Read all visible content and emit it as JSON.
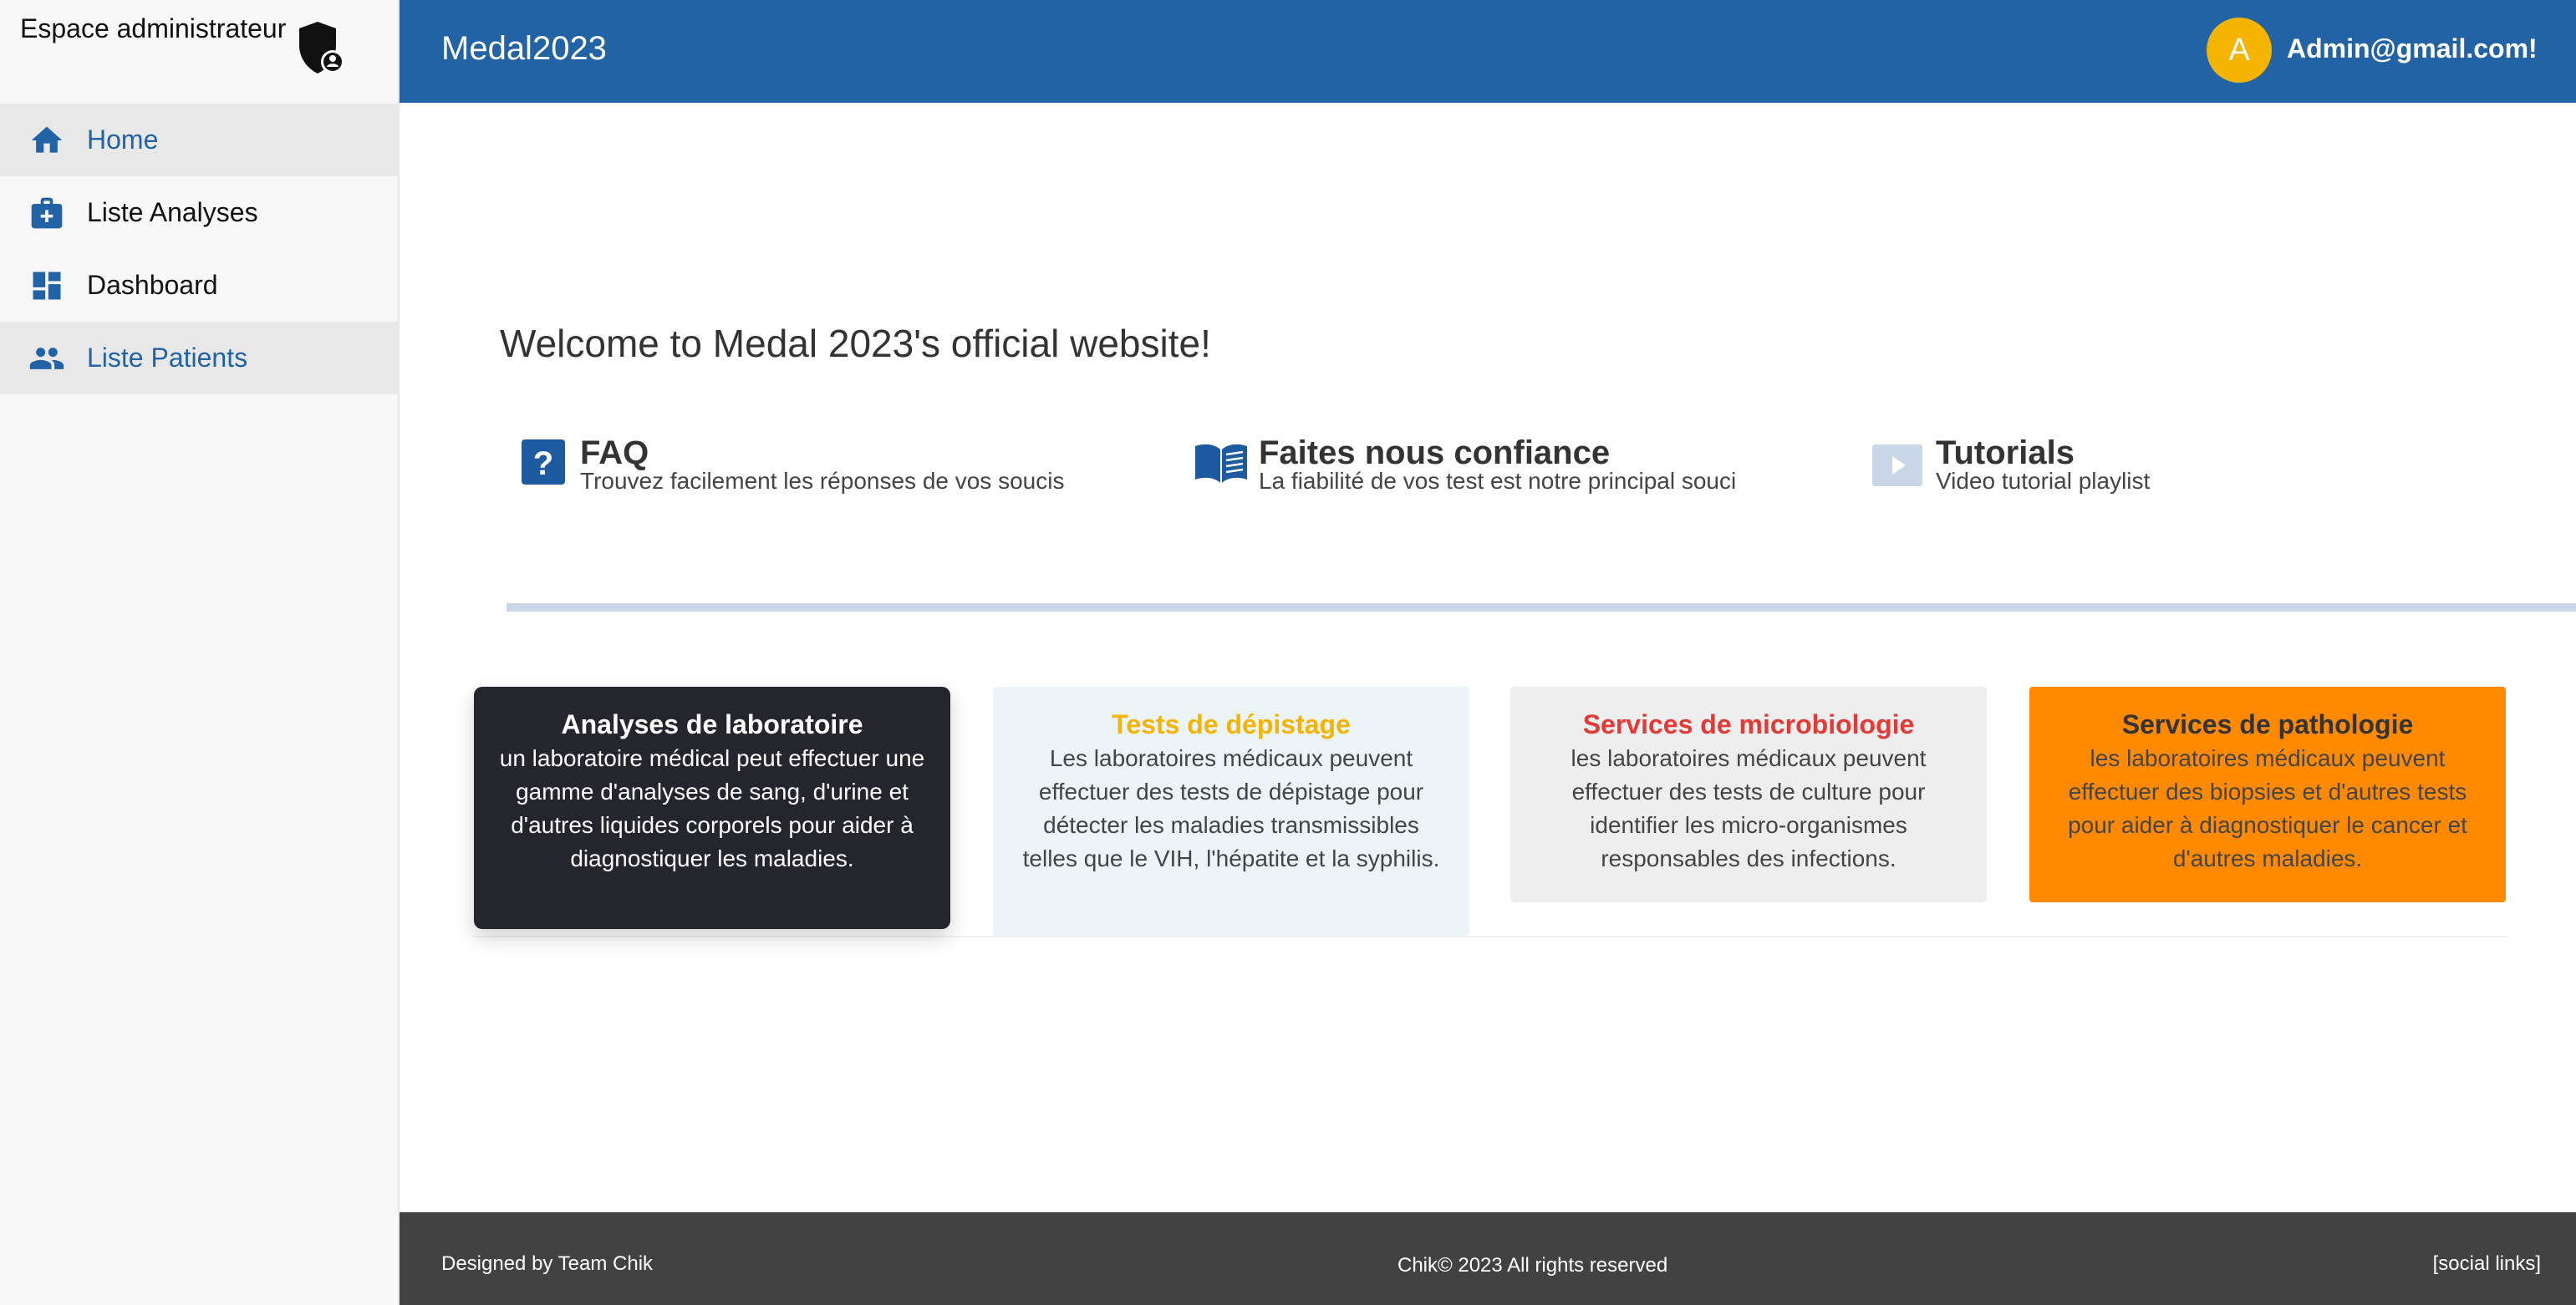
{
  "sidebar": {
    "brand": "Espace administrateur",
    "items": [
      {
        "label": "Home",
        "icon": "home-icon",
        "active": true
      },
      {
        "label": "Liste Analyses",
        "icon": "medical-kit-icon",
        "active": false
      },
      {
        "label": "Dashboard",
        "icon": "dashboard-icon",
        "active": false
      },
      {
        "label": "Liste Patients",
        "icon": "people-icon",
        "active": true
      }
    ]
  },
  "header": {
    "title": "Medal2023",
    "avatar_initial": "A",
    "user_email": "Admin@gmail.com!"
  },
  "main": {
    "welcome": "Welcome to Medal 2023's official website!",
    "features": [
      {
        "title": "FAQ",
        "subtitle": "Trouvez facilement les réponses de vos soucis",
        "icon": "question-icon"
      },
      {
        "title": "Faites nous confiance",
        "subtitle": "La fiabilité de vos test est notre principal souci",
        "icon": "book-icon"
      },
      {
        "title": "Tutorials",
        "subtitle": "Video tutorial playlist",
        "icon": "play-icon"
      }
    ],
    "cards": [
      {
        "title": "Analyses de laboratoire",
        "text": "un laboratoire médical peut effectuer une gamme d'analyses de sang, d'urine et d'autres liquides corporels pour aider à diagnostiquer les maladies.",
        "bg": "#25262d",
        "title_color": "#ffffff",
        "text_color": "#ffffff"
      },
      {
        "title": "Tests de dépistage",
        "text": "Les laboratoires médicaux peuvent effectuer des tests de dépistage pour détecter les maladies transmissibles telles que le VIH, l'hépatite et la syphilis.",
        "bg": "#edf4f7",
        "title_color": "#f4b400",
        "text_color": "#444444"
      },
      {
        "title": "Services de microbiologie",
        "text": "les laboratoires médicaux peuvent effectuer des tests de culture pour identifier les micro-organismes responsables des infections.",
        "bg": "#eeeeee",
        "title_color": "#e53935",
        "text_color": "#444444"
      },
      {
        "title": "Services de pathologie",
        "text": "les laboratoires médicaux peuvent effectuer des biopsies et d'autres tests pour aider à diagnostiquer le cancer et d'autres maladies.",
        "bg": "#ff8a00",
        "title_color": "#333333",
        "text_color": "#444444"
      }
    ]
  },
  "footer": {
    "left": "Designed by Team Chik",
    "center": "Chik© 2023 All rights reserved",
    "right": "[social links]"
  },
  "colors": {
    "primary": "#2263a5",
    "avatar": "#f4b400",
    "footer": "#424242"
  }
}
